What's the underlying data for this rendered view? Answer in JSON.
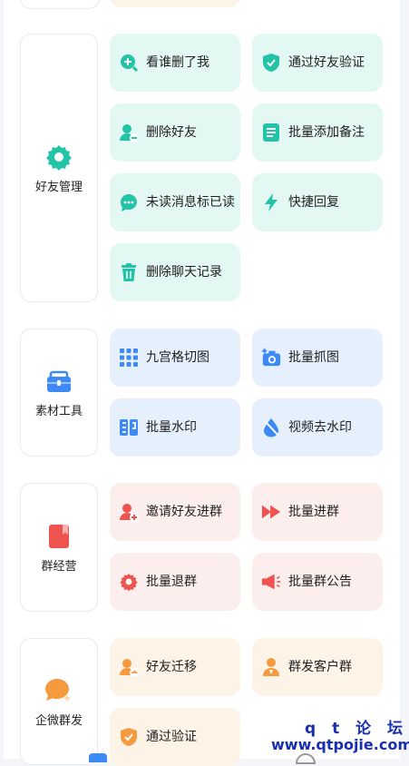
{
  "colors": {
    "teal": "#22c3a6",
    "blue": "#3d8af7",
    "red": "#ef5350",
    "orange": "#f59a3e"
  },
  "sections": [
    {
      "name": "好友管理",
      "icon": "gear-icon",
      "items": [
        {
          "label": "看谁删了我",
          "icon": "search-plus-icon"
        },
        {
          "label": "通过好友验证",
          "icon": "shield-check-icon"
        },
        {
          "label": "删除好友",
          "icon": "user-remove-icon"
        },
        {
          "label": "批量添加备注",
          "icon": "note-list-icon"
        },
        {
          "label": "未读消息标已读",
          "icon": "chat-bubble-icon"
        },
        {
          "label": "快捷回复",
          "icon": "lightning-icon"
        },
        {
          "label": "删除聊天记录",
          "icon": "trash-icon"
        }
      ]
    },
    {
      "name": "素材工具",
      "icon": "toolbox-icon",
      "items": [
        {
          "label": "九宫格切图",
          "icon": "grid-icon"
        },
        {
          "label": "批量抓图",
          "icon": "camera-plus-icon"
        },
        {
          "label": "批量水印",
          "icon": "watermark-icon"
        },
        {
          "label": "视频去水印",
          "icon": "drop-icon"
        }
      ]
    },
    {
      "name": "群经营",
      "icon": "bookmark-book-icon",
      "items": [
        {
          "label": "邀请好友进群",
          "icon": "user-invite-icon"
        },
        {
          "label": "批量进群",
          "icon": "fast-forward-icon"
        },
        {
          "label": "批量退群",
          "icon": "gear-red-icon"
        },
        {
          "label": "批量群公告",
          "icon": "megaphone-icon"
        }
      ]
    },
    {
      "name": "企微群发",
      "icon": "chat-bubble-orange-icon",
      "items": [
        {
          "label": "好友迁移",
          "icon": "user-transfer-icon"
        },
        {
          "label": "群发客户群",
          "icon": "user-group-icon"
        },
        {
          "label": "通过验证",
          "icon": "shield-check-orange-icon"
        }
      ]
    }
  ],
  "watermark": {
    "line1": "q t 论 坛",
    "line2": "www.qtpojie.com"
  }
}
